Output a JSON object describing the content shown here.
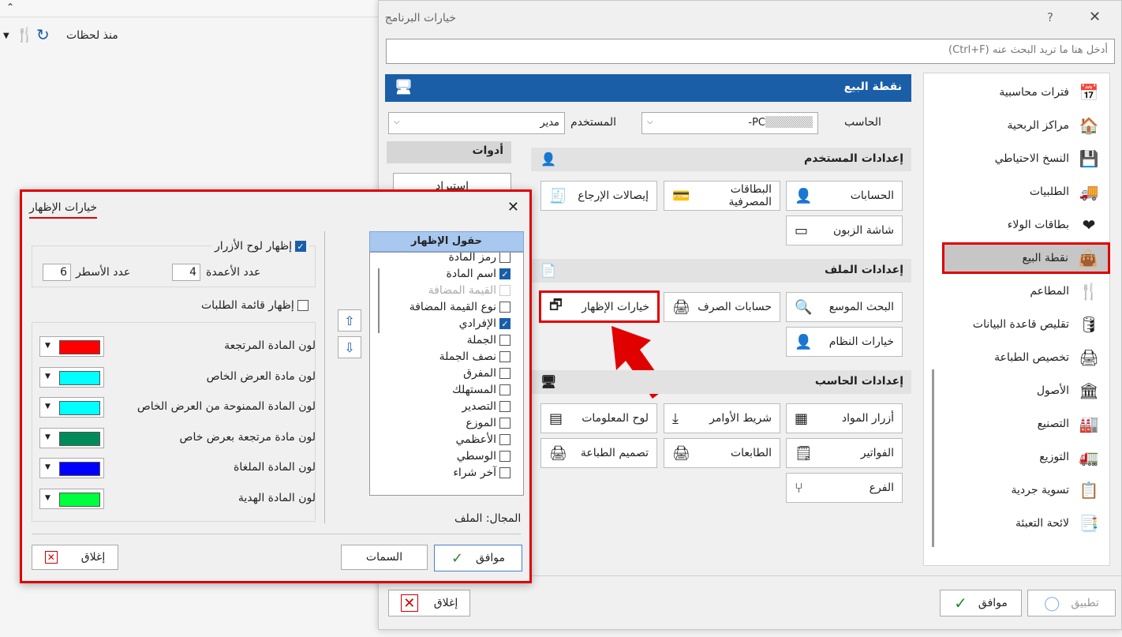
{
  "bg": {
    "since_label": "منذ لحظات"
  },
  "main": {
    "title": "خيارات البرنامج",
    "help": "?",
    "close": "✕",
    "search_placeholder": "أدخل هنا ما تريد البحث عنه (Ctrl+F)",
    "sidebar": [
      {
        "label": "فترات محاسبية",
        "icon": "calendar-icon",
        "glyph": "📅"
      },
      {
        "label": "مراكز الربحية",
        "icon": "profit-center-icon",
        "glyph": "🏠"
      },
      {
        "label": "النسخ الاحتياطي",
        "icon": "backup-icon",
        "glyph": "💾"
      },
      {
        "label": "الطلبيات",
        "icon": "orders-icon",
        "glyph": "🚚"
      },
      {
        "label": "بطاقات الولاء",
        "icon": "heart-icon",
        "glyph": "❤"
      },
      {
        "label": "نقطة البيع",
        "icon": "bag-icon",
        "glyph": "👜"
      },
      {
        "label": "المطاعم",
        "icon": "restaurant-icon",
        "glyph": "🍴"
      },
      {
        "label": "تقليص قاعدة البيانات",
        "icon": "database-icon",
        "glyph": "🛢"
      },
      {
        "label": "تخصيص الطباعة",
        "icon": "printer-icon",
        "glyph": "🖨"
      },
      {
        "label": "الأصول",
        "icon": "assets-icon",
        "glyph": "🏛"
      },
      {
        "label": "التصنيع",
        "icon": "factory-icon",
        "glyph": "🏭"
      },
      {
        "label": "التوزيع",
        "icon": "truck-icon",
        "glyph": "🚛"
      },
      {
        "label": "تسوية جردية",
        "icon": "clipboard-icon",
        "glyph": "📋"
      },
      {
        "label": "لائحة التعبئة",
        "icon": "packing-list-icon",
        "glyph": "📑"
      }
    ],
    "panel_title": "نقطة البيع",
    "computer_label": "الحاسب",
    "computer_value": "PC-",
    "user_label": "المستخدم",
    "user_value": "مدير",
    "tools_label": "أدوات",
    "import_label": "استيراد",
    "sections": {
      "user": "إعدادات المستخدم",
      "file": "إعدادات الملف",
      "computer": "إعدادات الحاسب"
    },
    "tiles": {
      "accounts": "الحسابات",
      "bank_cards": "البطاقات المصرفية",
      "return_receipts": "إيصالات الإرجاع",
      "customer_screen": "شاشة الزبون",
      "extended_search": "البحث الموسع",
      "exchange_accounts": "حسابات الصرف",
      "display_options": "خيارات الإظهار",
      "system_options": "خيارات النظام",
      "item_buttons": "أزرار المواد",
      "command_bar": "شريط الأوامر",
      "info_board": "لوح المعلومات",
      "invoices": "الفواتير",
      "printers": "الطابعات",
      "print_design": "تصميم الطباعة",
      "branch": "الفرع"
    },
    "ok": "موافق",
    "apply": "تطبيق",
    "close_btn": "إغلاق"
  },
  "dialog": {
    "title": "خيارات الإظهار",
    "close": "✕",
    "fields_header": "حقول الإظهار",
    "fields": [
      {
        "label": "رمز المادة",
        "checked": false,
        "disabled": false
      },
      {
        "label": "اسم المادة",
        "checked": true,
        "disabled": false
      },
      {
        "label": "القيمة المضافة",
        "checked": false,
        "disabled": true
      },
      {
        "label": "نوع القيمة المضافة",
        "checked": false,
        "disabled": false
      },
      {
        "label": "الإفرادي",
        "checked": true,
        "disabled": false
      },
      {
        "label": "الجملة",
        "checked": false,
        "disabled": false
      },
      {
        "label": "نصف الجملة",
        "checked": false,
        "disabled": false
      },
      {
        "label": "المفرق",
        "checked": false,
        "disabled": false
      },
      {
        "label": "المستهلك",
        "checked": false,
        "disabled": false
      },
      {
        "label": "التصدير",
        "checked": false,
        "disabled": false
      },
      {
        "label": "الموزع",
        "checked": false,
        "disabled": false
      },
      {
        "label": "الأعظمي",
        "checked": false,
        "disabled": false
      },
      {
        "label": "الوسطي",
        "checked": false,
        "disabled": false
      },
      {
        "label": "آخر شراء",
        "checked": false,
        "disabled": false
      }
    ],
    "scope_label": "المجال: الملف",
    "show_buttons_panel": "إظهار لوح الأزرار",
    "columns_label": "عدد الأعمدة",
    "columns_value": "4",
    "rows_label": "عدد الأسطر",
    "rows_value": "6",
    "show_orders_list": "إظهار قائمة الطلبات",
    "colors": [
      {
        "label": "لون المادة المرتجعة",
        "color": "#ff0000"
      },
      {
        "label": "لون مادة العرض الخاص",
        "color": "#00ffff"
      },
      {
        "label": "لون المادة الممنوحة من العرض الخاص",
        "color": "#00ffff"
      },
      {
        "label": "لون مادة مرتجعة بعرض خاص",
        "color": "#008c5a"
      },
      {
        "label": "لون المادة الملغاة",
        "color": "#0000ff"
      },
      {
        "label": "لون المادة الهدية",
        "color": "#00ff3c"
      }
    ],
    "ok": "موافق",
    "themes": "السمات",
    "close_btn": "إغلاق"
  }
}
